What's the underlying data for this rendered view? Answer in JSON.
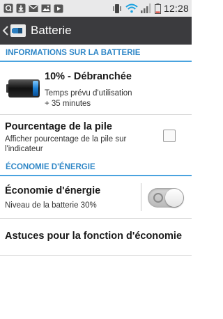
{
  "status_bar": {
    "time": "12:28",
    "icons": [
      "q-app-icon",
      "download-icon",
      "email-icon",
      "image-icon",
      "youtube-icon",
      "vibrate-icon",
      "wifi-icon",
      "signal-icon",
      "battery-icon"
    ]
  },
  "title_bar": {
    "title": "Batterie",
    "back_icon": "chevron-left-icon",
    "app_icon": "battery-settings-icon"
  },
  "sections": {
    "battery_info_header": "INFORMATIONS SUR LA BATTERIE",
    "energy_saving_header": "ÉCONOMIE D'ÉNERGIE"
  },
  "battery": {
    "level_percent": 10,
    "status_text": "10% - Débranchée",
    "estimate_line1": "Temps prévu d'utilisation",
    "estimate_line2": "+ 35 minutes"
  },
  "battery_percentage": {
    "title": "Pourcentage de la pile",
    "subtitle_line1": "Afficher pourcentage de la pile sur",
    "subtitle_line2": "l'indicateur",
    "checked": false
  },
  "energy_saver": {
    "title": "Économie d'énergie",
    "subtitle": "Niveau de la batterie 30%",
    "enabled": false
  },
  "tips": {
    "title": "Astuces pour la fonction d'économie"
  },
  "colors": {
    "accent": "#2f87c7",
    "title_bar": "#3b3b3e",
    "status_bar": "#e9e9ea"
  }
}
